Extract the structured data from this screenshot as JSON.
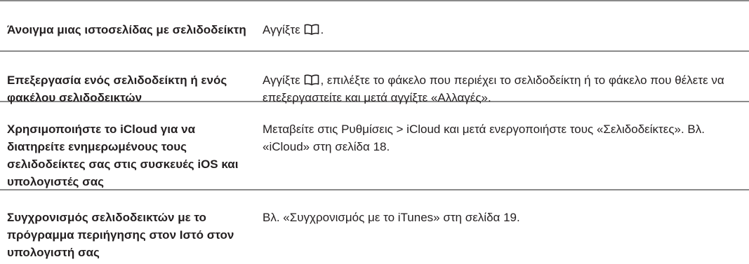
{
  "rows": [
    {
      "task": "Άνοιγμα μιας ιστοσελίδας με σελιδοδείκτη",
      "how_before_icon": "Αγγίξτε",
      "icon": "bookmarks-book-icon",
      "how_after_icon": "."
    },
    {
      "task": "Επεξεργασία ενός σελιδοδείκτη ή ενός φακέλου σελιδοδεικτών",
      "how_before_icon": "Αγγίξτε",
      "icon": "bookmarks-book-icon",
      "how_after_icon": ", επιλέξτε το φάκελο που περιέχει το σελιδοδείκτη ή το φάκελο που θέλετε να επεξεργαστείτε και μετά αγγίξτε «Αλλαγές»."
    },
    {
      "task": "Χρησιμοποιήστε το iCloud για να διατηρείτε ενημερωμένους τους σελιδοδείκτες σας στις συσκευές iOS και υπολογιστές σας",
      "how": "Μεταβείτε στις Ρυθμίσεις > iCloud και μετά ενεργοποιήστε τους «Σελιδοδείκτες». Βλ. «iCloud» στη σελίδα 18."
    },
    {
      "task": "Συγχρονισμός σελιδοδεικτών με το πρόγραμμα περιήγησης στον Ιστό στον υπολογιστή σας",
      "how": "Βλ. «Συγχρονισμός με το iTunes» στη σελίδα 19."
    }
  ],
  "colors": {
    "rule": "#8a8a8a",
    "text": "#231f20"
  }
}
